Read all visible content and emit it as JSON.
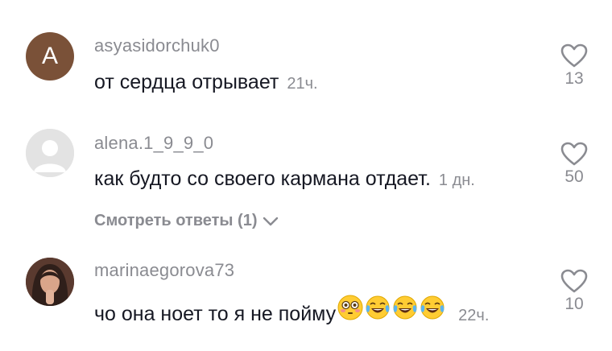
{
  "comments": [
    {
      "username": "asyasidorchuk0",
      "avatar_letter": "A",
      "text": "от сердца отрывает",
      "time": "21ч.",
      "likes": "13",
      "avatar_color": "#7a5138"
    },
    {
      "username": "alena.1_9_9_0",
      "text": "как будто со своего кармана отдает.",
      "time": "1 дн.",
      "likes": "50",
      "view_replies": "Смотреть ответы (1)"
    },
    {
      "username": "marinaegorova73",
      "text": "чо она ноет то я не пойму",
      "emojis": [
        "flushed-face-emoji",
        "face-with-tears-of-joy-emoji",
        "face-with-tears-of-joy-emoji",
        "face-with-tears-of-joy-emoji"
      ],
      "time": "22ч.",
      "likes": "10"
    }
  ],
  "colors": {
    "secondary_text": "#8a8b91",
    "primary_text": "#161823"
  }
}
